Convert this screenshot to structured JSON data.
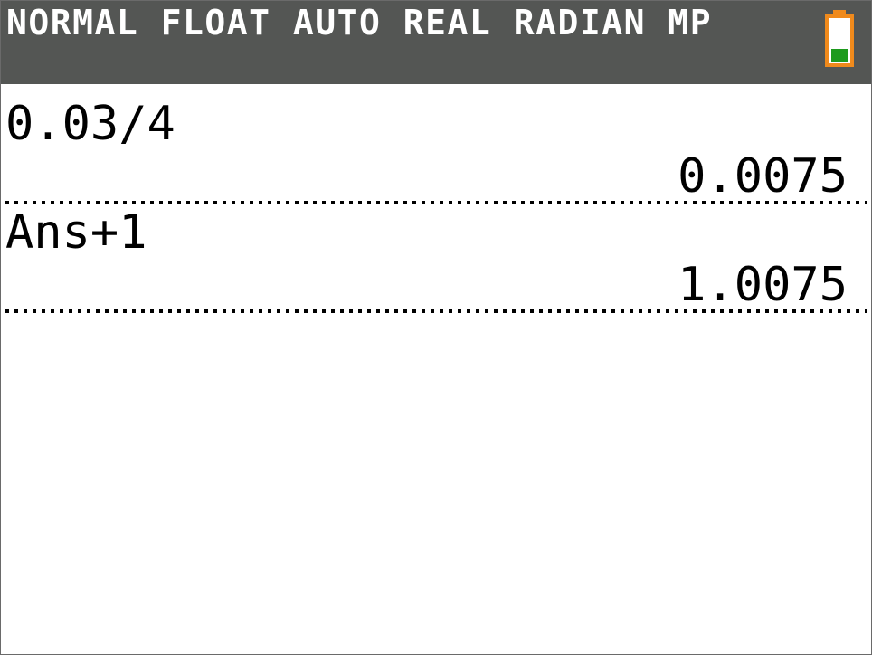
{
  "status_bar": {
    "mode_text": "NORMAL FLOAT AUTO REAL RADIAN MP",
    "battery_icon": "battery-icon",
    "battery_color": "#f08a1c",
    "battery_fill_color": "#1d9a1d",
    "background_color": "#545654"
  },
  "history": [
    {
      "expression": "0.03/4",
      "result": "0.0075"
    },
    {
      "expression": "Ans+1",
      "result": "1.0075"
    }
  ]
}
